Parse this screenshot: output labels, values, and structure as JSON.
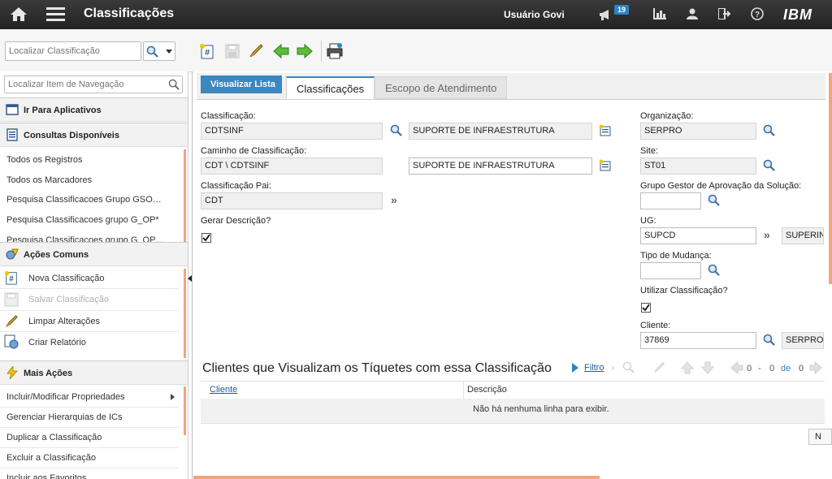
{
  "header": {
    "app_title": "Classificações",
    "user_name": "Usuário Govi",
    "notification_count": "19",
    "logo": "IBM"
  },
  "toolbar": {
    "search_placeholder": "Localizar Classificação"
  },
  "leftnav": {
    "search_placeholder": "Localizar Item de Navegação",
    "go_to_apps": "Ir Para Aplicativos",
    "queries_title": "Consultas Disponíveis",
    "queries": [
      "Todos os Registros",
      "Todos os Marcadores",
      "Pesquisa Classificacoes Grupo GSO…",
      "Pesquisa Classificacoes grupo G_OP*",
      "Pesquisa Classificacoes grupo G_OP…"
    ],
    "common_actions_title": "Ações Comuns",
    "common_actions": [
      "Nova Classificação",
      "Salvar Classificação",
      "Limpar Alterações",
      "Criar Relatório"
    ],
    "more_actions_title": "Mais Ações",
    "more_actions": [
      "Incluir/Modificar Propriedades",
      "Gerenciar Hierarquias de ICs",
      "Duplicar a Classificação",
      "Excluir a Classificação",
      "Incluir aos Favoritos"
    ]
  },
  "tabs": {
    "back_label": "Visualizar Lista",
    "items": [
      "Classificações",
      "Escopo de Atendimento"
    ]
  },
  "form": {
    "classificacao_label": "Classificação:",
    "classificacao_value": "CDTSINF",
    "classificacao_desc": "SUPORTE DE INFRAESTRUTURA",
    "caminho_label": "Caminho de Classificação:",
    "caminho_value": "CDT \\ CDTSINF",
    "caminho_desc": "SUPORTE DE INFRAESTRUTURA",
    "pai_label": "Classificação Pai:",
    "pai_value": "CDT",
    "gerar_label": "Gerar Descrição?",
    "org_label": "Organização:",
    "org_value": "SERPRO",
    "site_label": "Site:",
    "site_value": "ST01",
    "grupo_label": "Grupo Gestor de Aprovação da Solução:",
    "grupo_value": "",
    "ug_label": "UG:",
    "ug_value": "SUPCD",
    "ug_desc": "SUPERINT",
    "tipo_label": "Tipo de Mudança:",
    "tipo_value": "",
    "utilizar_label": "Utilizar Classificação?",
    "cliente_label": "Cliente:",
    "cliente_value": "37869",
    "cliente_desc": "SERPRO"
  },
  "table": {
    "title": "Clientes que Visualizam os Tíquetes com essa Classificação",
    "filter_label": "Filtro",
    "pager_start": "0",
    "pager_dash": "-",
    "pager_end": "0",
    "pager_of": "de",
    "pager_total": "0",
    "columns": [
      "Cliente",
      "Descrição"
    ],
    "empty_message": "Não há nenhuma linha para exibir.",
    "new_row_button": "N"
  },
  "colors": {
    "accent": "#3c87bd",
    "topbar": "#2b2b2b",
    "scroll_accent": "#f2a57b"
  }
}
